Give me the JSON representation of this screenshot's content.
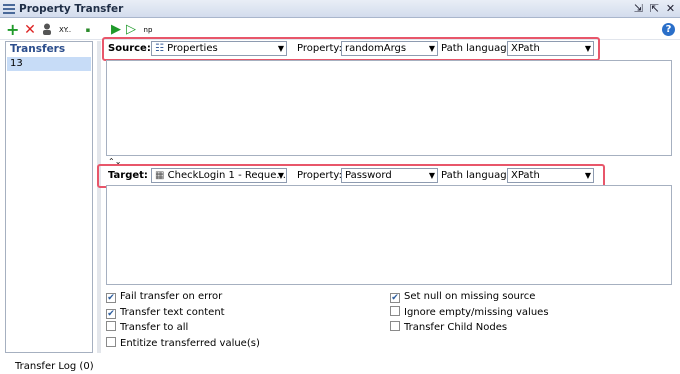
{
  "window": {
    "title": "Property Transfer",
    "controls": [
      "restore-icon",
      "maximize-icon",
      "close-icon"
    ]
  },
  "toolbar": {
    "add_icon": "plus-icon",
    "delete_icon": "delete-icon",
    "label_1": "XY..",
    "label_2": "np",
    "run_icon": "run-icon",
    "run_all_icon": "run-all-icon",
    "help_label": "?"
  },
  "transfers": {
    "header": "Transfers",
    "items": [
      "13"
    ]
  },
  "source": {
    "label": "Source:",
    "value": "Properties",
    "property_label": "Property:",
    "property_value": "randomArgs",
    "path_language_label": "Path language:",
    "path_language_value": "XPath"
  },
  "target": {
    "label": "Target:",
    "value": "CheckLogin 1 - Reque...",
    "property_label": "Property:",
    "property_value": "Password",
    "path_language_label": "Path language:",
    "path_language_value": "XPath"
  },
  "options": [
    {
      "label": "Fail transfer on error",
      "checked": true
    },
    {
      "label": "Transfer text content",
      "checked": true
    },
    {
      "label": "Transfer to all",
      "checked": false
    },
    {
      "label": "Entitize transferred value(s)",
      "checked": false
    },
    {
      "label": "Set null on missing source",
      "checked": true
    },
    {
      "label": "Ignore empty/missing values",
      "checked": false
    },
    {
      "label": "Transfer Child Nodes",
      "checked": false
    }
  ],
  "log": {
    "label": "Transfer Log (0)"
  },
  "colors": {
    "highlight_box": "#e8566a",
    "selection": "#c7dcf7"
  }
}
